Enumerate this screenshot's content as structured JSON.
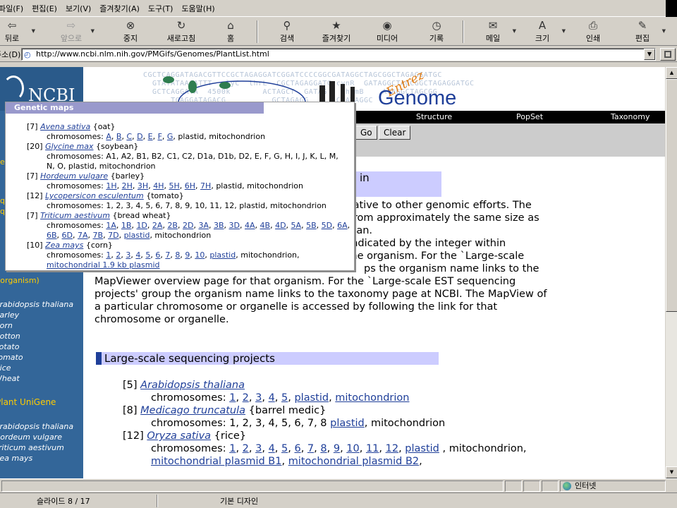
{
  "menu": [
    "파일(F)",
    "편집(E)",
    "보기(V)",
    "즐겨찾기(A)",
    "도구(T)",
    "도움말(H)"
  ],
  "toolbar": {
    "back": "뒤로",
    "forward": "앞으로",
    "stop": "중지",
    "refresh": "새로고침",
    "home": "홈",
    "search": "검색",
    "favorites": "즐겨찾기",
    "media": "미디어",
    "history": "기록",
    "mail": "메일",
    "size": "크기",
    "print": "인쇄",
    "edit": "편집"
  },
  "address": {
    "label": "주소(D)",
    "url": "http://www.ncbi.nlm.nih.gov/PMGifs/Genomes/PlantList.html"
  },
  "nav": {
    "ncbi": "NCBI",
    "organism_note": "(organism)",
    "genome_links": [
      "Arabidopsis thaliana",
      "Barley",
      "Corn",
      "Cotton",
      "Potato",
      "Tomato",
      "Rice",
      "Wheat"
    ],
    "unigene_head": "Plant UniGene",
    "unigene_links": [
      "Arabidopsis thaliana",
      "Hordeum vulgare",
      "Triticum aestivum",
      "Zea mays"
    ]
  },
  "banner": {
    "entrez": "Entrez",
    "genome": "Genome",
    "dna_line1": "CGCTCAGGATAGACGTTCCGCTAGAGGATCGGATCCCCGGCGATAGGCTAGCGGCTAGAGGATGC",
    "dna_line2": "  GTATATAAGATTT  glyC  thrL  CGCTAGAGGATC cynR  GATAGGCTAGCGGCTAGAGGATGC",
    "dna_line3": "  GCTCAGGATA  4500k       ACTAGCT  GATAG    hemB    ATAGGCTAGCGG",
    "dna_line4": "      TCAGGATAGACG          GCTAGAGG      CGATAGGC"
  },
  "tabs": [
    "Structure",
    "PopSet",
    "Taxonomy"
  ],
  "search_buttons": {
    "go": "Go",
    "clear": "Clear"
  },
  "intro": {
    "heading_fragment": "in",
    "lines": [
      "relative to other genomic efforts. The",
      "g from approximately the same size as",
      "uman.",
      "s indicated by the integer within",
      "f the organism. For the `Large-scale",
      "MapViewer overview page for that organism. For the `Large-scale EST sequencing",
      "projects' group the organism name links to the taxonomy page at NCBI. The MapView of",
      "a particular chromosome or organelle is accessed by following the link for that",
      "chromosome or organelle."
    ],
    "partial_line": "ps the organism name links to the"
  },
  "large_scale": {
    "heading": "Large-scale sequencing projects",
    "entries": [
      {
        "count": "[5]",
        "name": "Arabidopsis thaliana",
        "common": "",
        "chromosomes_label": "chromosomes:",
        "linked": [
          "1",
          "2",
          "3",
          "4",
          "5",
          "plastid",
          "mitochondrion"
        ],
        "plain": []
      },
      {
        "count": "[8]",
        "name": "Medicago truncatula",
        "common": "{barrel medic}",
        "chromosomes_label": "chromosomes:",
        "plain_prefix": "1, 2, 3, 4, 5, 6, 7, 8",
        "linked": [
          "plastid"
        ],
        "plain_suffix": ", mitochondrion"
      },
      {
        "count": "[12]",
        "name": "Oryza sativa",
        "common": "{rice}",
        "chromosomes_label": "chromosomes:",
        "linked": [
          "1",
          "2",
          "3",
          "4",
          "5",
          "6",
          "7",
          "8",
          "9",
          "10",
          "11",
          "12",
          "plastid"
        ],
        "plain_suffix": " , mitochondrion,",
        "line2": [
          "mitochondrial plasmid B1",
          "mitochondrial plasmid B2"
        ]
      }
    ]
  },
  "popup": {
    "title": "Genetic maps",
    "entries": [
      {
        "count": "[7]",
        "name": "Avena sativa",
        "common": "{oat}",
        "chrom_line": [
          "A",
          "B",
          "C",
          "D",
          "E",
          "F",
          "G"
        ],
        "chrom_tail": ", plastid, mitochondrion"
      },
      {
        "count": "[20]",
        "name": "Glycine max",
        "common": "{soybean}",
        "chrom_text1": "chromosomes: A1, A2, B1, B2, C1, C2, D1a, D1b, D2, E, F, G, H, I, J, K, L, M,",
        "chrom_text2": "N, O, plastid, mitochondrion"
      },
      {
        "count": "[7]",
        "name": "Hordeum vulgare",
        "common": "{barley}",
        "chrom_line": [
          "1H",
          "2H",
          "3H",
          "4H",
          "5H",
          "6H",
          "7H"
        ],
        "chrom_tail": ", plastid, mitochondrion"
      },
      {
        "count": "[12]",
        "name": "Lycopersicon esculentum",
        "common": "{tomato}",
        "chrom_text1": "chromosomes: 1, 2, 3, 4, 5, 6, 7, 8, 9, 10, 11, 12, plastid, mitochondrion"
      },
      {
        "count": "[7]",
        "name": "Triticum aestivum",
        "common": "{bread wheat}",
        "chrom_line": [
          "1A",
          "1B",
          "1D",
          "2A",
          "2B",
          "2D",
          "3A",
          "3B",
          "3D",
          "4A",
          "4B",
          "4D",
          "5A",
          "5B",
          "5D",
          "6A"
        ],
        "chrom_line2": [
          "6B",
          "6D",
          "7A",
          "7B",
          "7D",
          "plastid"
        ],
        "chrom_tail2": ", mitochondrion"
      },
      {
        "count": "[10]",
        "name": "Zea mays",
        "common": "{corn}",
        "chrom_line": [
          "1",
          "2",
          "3",
          "4",
          "5",
          "6",
          "7",
          "8",
          "9",
          "10",
          "plastid"
        ],
        "chrom_tail": ", mitochondrion,",
        "extra": "mitochondrial 1.9 kb plasmid"
      }
    ]
  },
  "status": {
    "zone": "인터넷"
  },
  "ppt": {
    "slide": "슬라이드 8 / 17",
    "design": "기본 디자인"
  }
}
